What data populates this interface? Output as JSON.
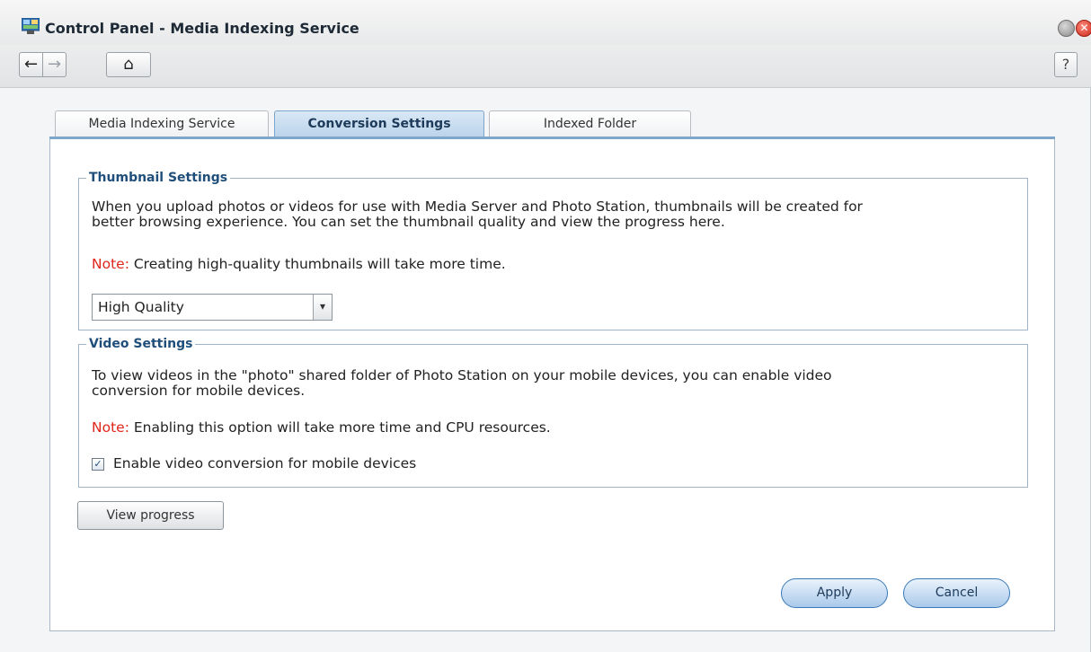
{
  "window": {
    "title": "Control Panel - Media Indexing Service",
    "close_glyph": "✕"
  },
  "toolbar": {
    "back_glyph": "←",
    "forward_glyph": "→",
    "home_glyph": "⌂",
    "help_glyph": "?"
  },
  "tabs": [
    {
      "label": "Media Indexing Service",
      "active": false
    },
    {
      "label": "Conversion Settings",
      "active": true
    },
    {
      "label": "Indexed Folder",
      "active": false
    }
  ],
  "thumbnail": {
    "legend": "Thumbnail Settings",
    "description_line1": "When you upload photos or videos for use with Media Server and Photo Station, thumbnails will be created for",
    "description_line2": "better browsing experience. You can set the thumbnail quality and view the progress here.",
    "note_label": "Note:",
    "note_text": " Creating high-quality thumbnails will take more time.",
    "quality_selected": "High Quality",
    "dropdown_glyph": "▾"
  },
  "video": {
    "legend": "Video Settings",
    "description_line1": "To view videos in the \"photo\" shared folder of Photo Station on your mobile devices, you can enable video",
    "description_line2": "conversion for mobile devices.",
    "note_label": "Note:",
    "note_text": " Enabling this option will take more time and CPU resources.",
    "checkbox_label": "Enable video conversion for mobile devices",
    "checkbox_checked": true,
    "check_glyph": "✓"
  },
  "buttons": {
    "view_progress": "View progress",
    "apply": "Apply",
    "cancel": "Cancel"
  },
  "colors": {
    "accent": "#1f4e7a",
    "note": "#e0261a",
    "tab_active": "#b9d2ea"
  }
}
